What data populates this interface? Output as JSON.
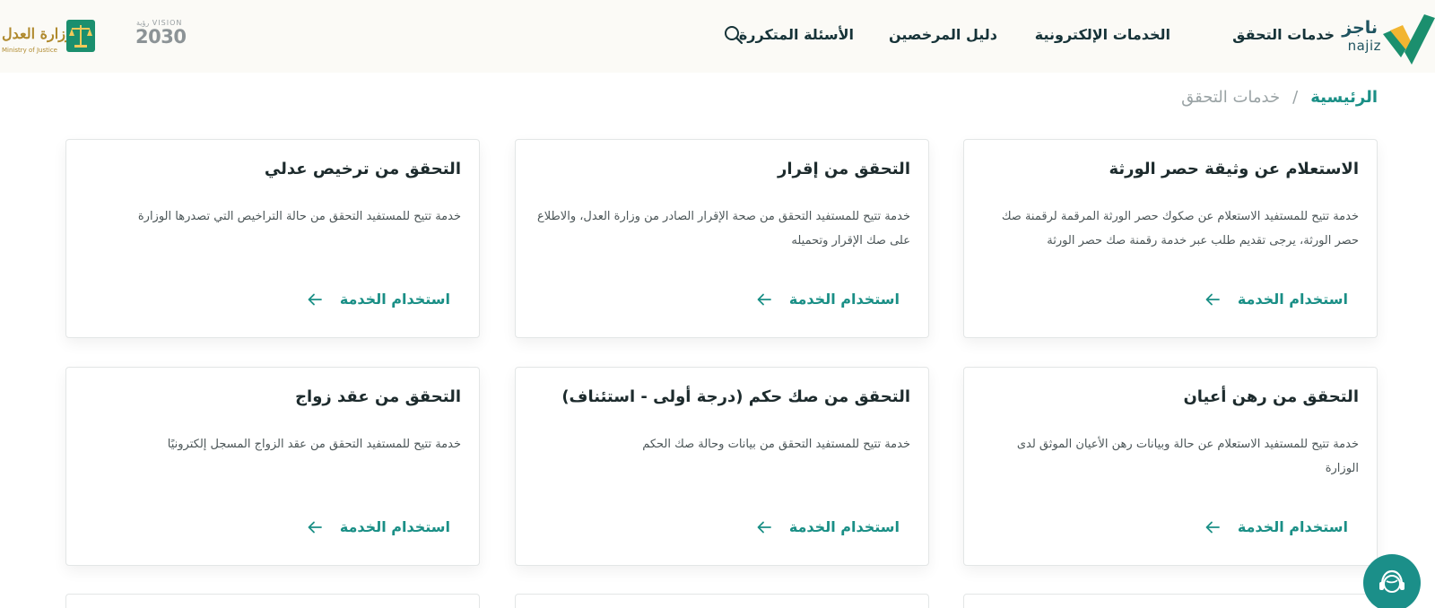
{
  "header": {
    "logo": {
      "arabic": "ناجز",
      "latin": "najiz"
    },
    "nav": [
      {
        "label": "خدمات التحقق"
      },
      {
        "label": "الخدمات الإلكترونية"
      },
      {
        "label": "دليل المرخصين"
      },
      {
        "label": "الأسئلة المتكررة"
      }
    ],
    "search_icon": "search-icon",
    "vision_logo": {
      "top": "VISION رؤية",
      "number": "2030"
    },
    "ministry_logo": {
      "arabic": "وزارة العدل",
      "english": "Ministry of Justice"
    }
  },
  "breadcrumb": {
    "home": "الرئيسية",
    "separator": "/",
    "current": "خدمات التحقق"
  },
  "cards": [
    {
      "title": "الاستعلام عن وثيقة حصر الورثة",
      "description": "خدمة تتيح للمستفيد الاستعلام عن صكوك حصر الورثة المرقمة لرقمنة صك حصر الورثة، يرجى تقديم طلب عبر خدمة رقمنة صك حصر الورثة",
      "action": "استخدام الخدمة"
    },
    {
      "title": "التحقق من إقرار",
      "description": "خدمة تتيح للمستفيد التحقق من صحة الإقرار الصادر من وزارة العدل، والاطلاع على صك الإقرار وتحميله",
      "action": "استخدام الخدمة"
    },
    {
      "title": "التحقق من ترخيص عدلي",
      "description": "خدمة تتيح للمستفيد التحقق من حالة التراخيص التي تصدرها الوزارة",
      "action": "استخدام الخدمة"
    },
    {
      "title": "التحقق من رهن أعيان",
      "description": "خدمة تتيح للمستفيد الاستعلام عن حالة وبيانات رهن الأعيان الموثق لدى الوزارة",
      "action": "استخدام الخدمة"
    },
    {
      "title": "التحقق من صك حكم (درجة أولى - استئناف)",
      "description": "خدمة تتيح للمستفيد التحقق من بيانات وحالة صك الحكم",
      "action": "استخدام الخدمة"
    },
    {
      "title": "التحقق من عقد زواج",
      "description": "خدمة تتيح للمستفيد التحقق من عقد الزواج المسجل إلكترونيًا",
      "action": "استخدام الخدمة"
    }
  ],
  "colors": {
    "accent": "#1a8f86",
    "header_bg": "#fbfaf6",
    "text_dark": "#1d2b2d",
    "text_muted": "#9aa3a5"
  },
  "chat_icon": "support-agent-icon"
}
